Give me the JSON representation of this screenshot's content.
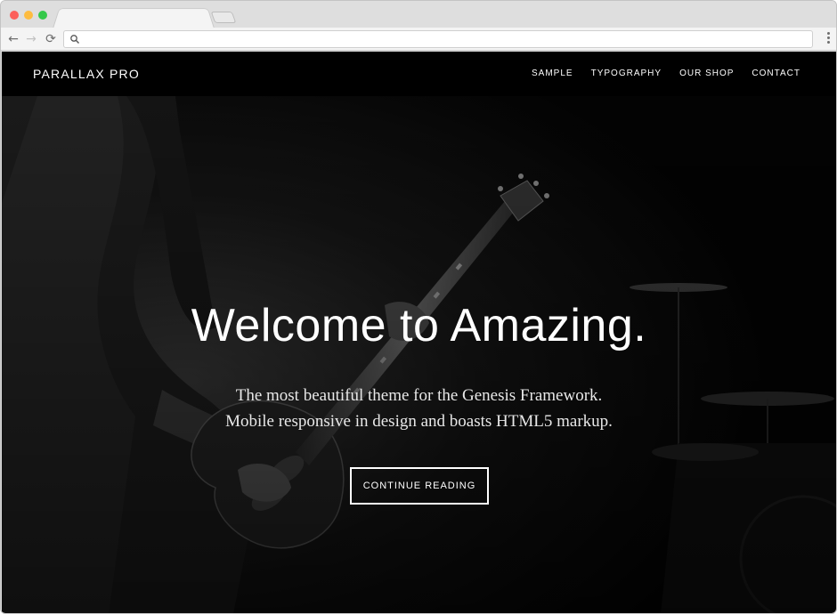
{
  "browser": {
    "address_bar": {
      "value": "",
      "icon": "search-icon"
    },
    "colors": {
      "close": "#fc605b",
      "minimize": "#fdbc40",
      "zoom": "#34c84a"
    }
  },
  "site": {
    "title": "PARALLAX PRO",
    "nav": [
      {
        "label": "SAMPLE"
      },
      {
        "label": "TYPOGRAPHY"
      },
      {
        "label": "OUR SHOP"
      },
      {
        "label": "CONTACT"
      }
    ]
  },
  "hero": {
    "title": "Welcome to Amazing.",
    "text_line1": "The most beautiful theme for the Genesis Framework.",
    "text_line2": "Mobile responsive in design and boasts HTML5 markup.",
    "button_label": "CONTINUE READING",
    "background": "black-and-white-guitarist-photo"
  }
}
